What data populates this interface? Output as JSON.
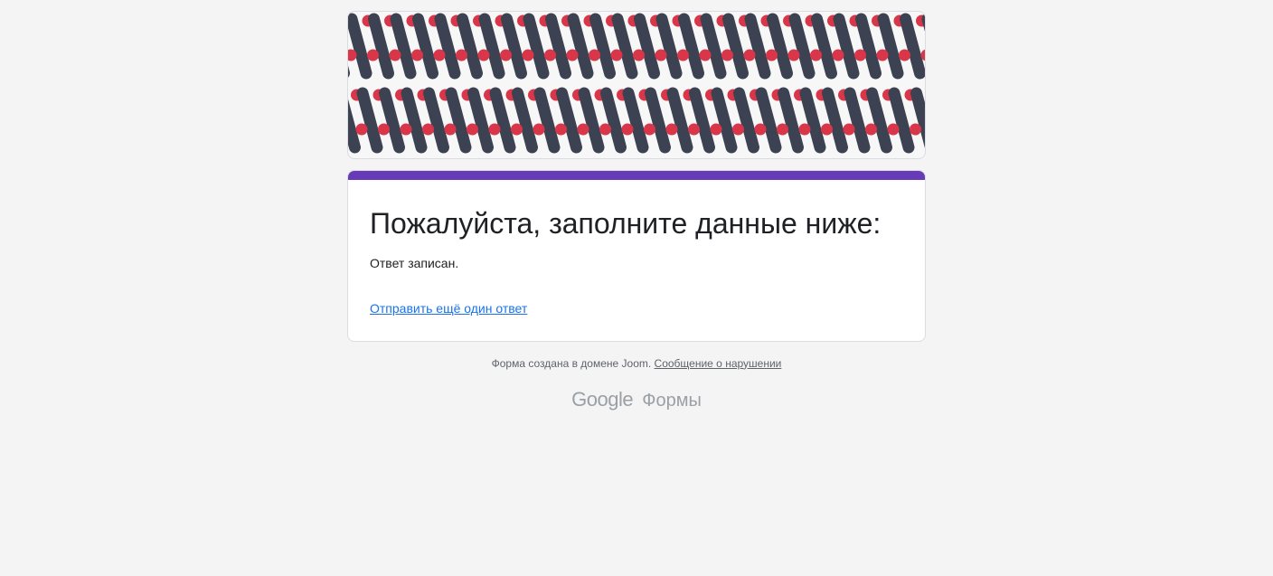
{
  "form": {
    "title": "Пожалуйста, заполните данные ниже:",
    "confirmation": "Ответ записан.",
    "submit_another_link": "Отправить ещё один ответ"
  },
  "footer": {
    "created_text": "Форма создана в домене Joom.",
    "report_link": "Сообщение о нарушении"
  },
  "branding": {
    "google": "Google",
    "product": "Формы"
  },
  "colors": {
    "accent": "#673ab7",
    "link": "#1a73e8",
    "banner_stroke": "#3d4252",
    "banner_dot": "#d9364a"
  }
}
